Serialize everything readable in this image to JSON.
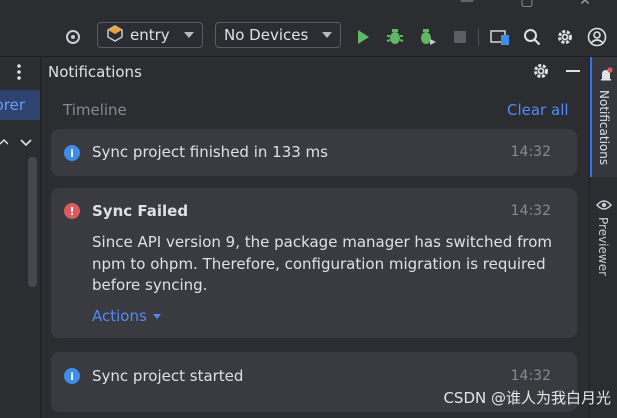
{
  "toolbar": {
    "run_config": "entry",
    "device": "No Devices"
  },
  "left_panel": {
    "tab_label": "orer"
  },
  "notifications": {
    "title": "Notifications",
    "timeline_label": "Timeline",
    "clear_all": "Clear all",
    "items": [
      {
        "type": "info",
        "text": "Sync project finished in 133 ms",
        "time": "14:32"
      },
      {
        "type": "error",
        "title": "Sync Failed",
        "time": "14:32",
        "body_lines": [
          "Since API version 9, the package manager has switched from",
          "npm to ohpm. Therefore, configuration migration is required",
          "before syncing."
        ],
        "actions": "Actions"
      },
      {
        "type": "info",
        "text": "Sync project started",
        "time": "14:32"
      }
    ]
  },
  "right_strip": {
    "notifications_tab": "Notifications",
    "previewer_tab": "Previewer"
  },
  "watermark": "CSDN @谁人为我白月光",
  "colors": {
    "background": "#2b2d30",
    "card": "#393b40",
    "link": "#548af7",
    "run_green": "#5fb865",
    "info_blue": "#3d8ee8",
    "error_red": "#db5c5c",
    "selected_tab": "#3574f0"
  }
}
